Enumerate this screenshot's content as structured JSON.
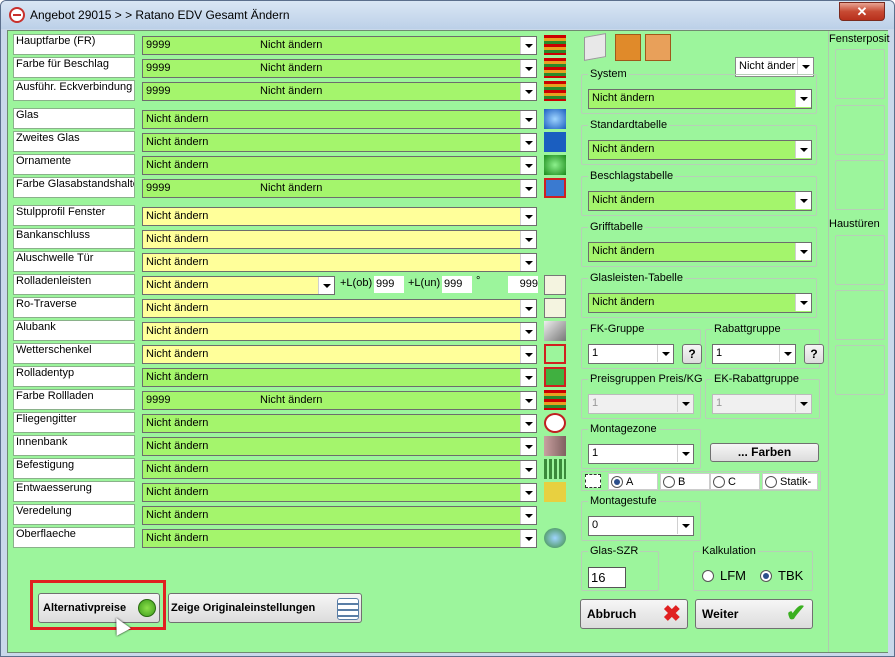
{
  "title": "Angebot 29015 >  > Ratano EDV  Gesamt Ändern",
  "close_label": "✕",
  "rows": [
    {
      "label": "Hauptfarbe (FR)",
      "code": "9999",
      "value": "Nicht ändern",
      "style": "g"
    },
    {
      "label": "Farbe für Beschlag",
      "code": "9999",
      "value": "Nicht ändern",
      "style": "g"
    },
    {
      "label": "Ausführ. Eckverbindung",
      "code": "9999",
      "value": "Nicht ändern",
      "style": "g"
    },
    {
      "label": "Glas",
      "code": "",
      "value": "Nicht ändern",
      "style": "g"
    },
    {
      "label": "Zweites Glas",
      "code": "",
      "value": "Nicht ändern",
      "style": "g"
    },
    {
      "label": "Ornamente",
      "code": "",
      "value": "Nicht ändern",
      "style": "g"
    },
    {
      "label": "Farbe Glasabstandshalte",
      "code": "9999",
      "value": "Nicht ändern",
      "style": "g"
    },
    {
      "label": "Stulpprofil Fenster",
      "code": "",
      "value": "Nicht ändern",
      "style": "y"
    },
    {
      "label": "Bankanschluss",
      "code": "",
      "value": "Nicht ändern",
      "style": "y"
    },
    {
      "label": "Aluschwelle Tür",
      "code": "",
      "value": "Nicht ändern",
      "style": "y"
    },
    {
      "label": "Rolladenleisten",
      "code": "",
      "value": "Nicht ändern",
      "style": "y"
    },
    {
      "label": "Ro-Traverse",
      "code": "",
      "value": "Nicht ändern",
      "style": "y"
    },
    {
      "label": "Alubank",
      "code": "",
      "value": "Nicht ändern",
      "style": "y"
    },
    {
      "label": "Wetterschenkel",
      "code": "",
      "value": "Nicht ändern",
      "style": "y"
    },
    {
      "label": "Rolladentyp",
      "code": "",
      "value": "Nicht ändern",
      "style": "g"
    },
    {
      "label": "Farbe Rollladen",
      "code": "9999",
      "value": "Nicht ändern",
      "style": "g"
    },
    {
      "label": "Fliegengitter",
      "code": "",
      "value": "Nicht ändern",
      "style": "g"
    },
    {
      "label": "Innenbank",
      "code": "",
      "value": "Nicht ändern",
      "style": "g"
    },
    {
      "label": "Befestigung",
      "code": "",
      "value": "Nicht ändern",
      "style": "g"
    },
    {
      "label": "Entwaesserung",
      "code": "",
      "value": "Nicht ändern",
      "style": "g"
    },
    {
      "label": "Veredelung",
      "code": "",
      "value": "Nicht ändern",
      "style": "g"
    },
    {
      "label": "Oberflaeche",
      "code": "",
      "value": "Nicht ändern",
      "style": "g"
    }
  ],
  "rolladen_extra": {
    "lob_label": "+L(ob)",
    "lob_value": "999",
    "lun_label": "+L(un)",
    "lun_value": "999",
    "deg_label": "°",
    "deg_value": "999"
  },
  "icons": [
    "color-stripes-icon",
    "color-stripes-icon",
    "color-stripes-icon",
    "glass-blue-icon",
    "glass-two-icon",
    "glass-green-icon",
    "glass-spacer-icon",
    "",
    "",
    "",
    "roller-strip-icon",
    "roller-traverse-icon",
    "alubank-icon",
    "weather-bar-icon",
    "roller-type-icon",
    "color-stripes-icon",
    "insect-screen-icon",
    "sill-icon",
    "fixing-icon",
    "drainage-icon",
    "",
    "surface-icon"
  ],
  "top_select": "Nicht änder",
  "groups": {
    "system": {
      "label": "System",
      "value": "Nicht ändern"
    },
    "standard": {
      "label": "Standardtabelle",
      "value": "Nicht ändern"
    },
    "beschlag": {
      "label": "Beschlagstabelle",
      "value": "Nicht ändern"
    },
    "griff": {
      "label": "Grifftabelle",
      "value": "Nicht ändern"
    },
    "glasleisten": {
      "label": "Glasleisten-Tabelle",
      "value": "Nicht ändern"
    },
    "fk": {
      "label": "FK-Gruppe",
      "value": "1",
      "help": "?"
    },
    "rabatt": {
      "label": "Rabattgruppe",
      "value": "1",
      "help": "?"
    },
    "preis": {
      "label": "Preisgruppen Preis/KG",
      "value": "1"
    },
    "ek": {
      "label": "EK-Rabattgruppe",
      "value": "1"
    },
    "montagezone": {
      "label": "Montagezone",
      "value": "1"
    },
    "montagestufe": {
      "label": "Montagestufe",
      "value": "0"
    },
    "glas_szr": {
      "label": "Glas-SZR",
      "value": "16"
    },
    "kalkulation": {
      "label": "Kalkulation",
      "lfm": "LFM",
      "tbk": "TBK"
    }
  },
  "farben_btn": "... Farben",
  "abc": {
    "a": "A",
    "b": "B",
    "c": "C",
    "statik": "Statik-"
  },
  "side": {
    "fensterpos": "Fensterposit",
    "haustueren": "Haustüren"
  },
  "buttons": {
    "alternativ": "Alternativpreise",
    "original": "Zeige Originaleinstellungen",
    "abbruch": "Abbruch",
    "weiter": "Weiter"
  }
}
